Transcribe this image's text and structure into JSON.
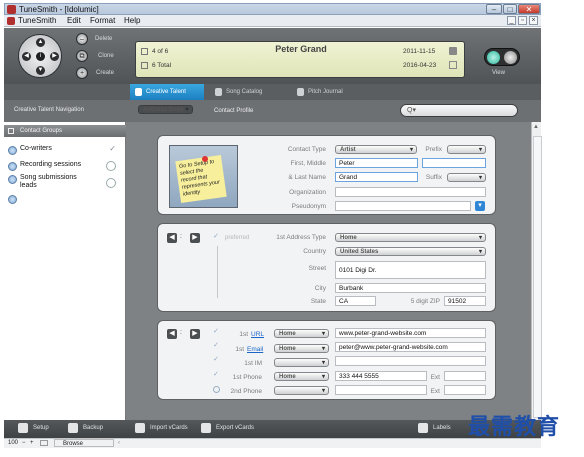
{
  "window": {
    "title": "TuneSmith - [Idolumic]"
  },
  "menu": {
    "app": "TuneSmith",
    "items": [
      "Edit",
      "Format",
      "Help"
    ]
  },
  "toolbar": {
    "delete_label": "Delete",
    "clone_label": "Clone",
    "create_label": "Create",
    "view_label": "View"
  },
  "lcd": {
    "record_pos": "4 of 6",
    "total": "6 Total",
    "name": "Peter Grand",
    "date1": "2011-11-15",
    "date2": "2016-04-23"
  },
  "tabs": [
    {
      "label": "Creative Talent",
      "active": true
    },
    {
      "label": "Song Catalog",
      "active": false
    },
    {
      "label": "Pitch Journal",
      "active": false
    }
  ],
  "subnav": {
    "title": "Creative Talent Navigation",
    "address_book": "Address Book",
    "contact_profile": "Contact Profile",
    "search_icon_text": "Q▾"
  },
  "left": {
    "header": "Contact Groups",
    "groups": [
      {
        "label": "Co-writers",
        "checked": true
      },
      {
        "label": "Recording sessions",
        "checked": false
      },
      {
        "label": "Song submissions leads",
        "checked": false
      }
    ]
  },
  "profile": {
    "sticky_note": "Go to Setup to select the record that represents your identity",
    "contact_type_label": "Contact Type",
    "contact_type": "Artist",
    "prefix_label": "Prefix",
    "prefix": "",
    "first_middle_label": "First, Middle",
    "first": "Peter",
    "middle": "",
    "last_name_label": "& Last Name",
    "last": "Grand",
    "suffix_label": "Suffix",
    "suffix": "",
    "organization_label": "Organization",
    "organization": "",
    "pseudonym_label": "Pseudonym",
    "pseudonym": ""
  },
  "address": {
    "preferred": "preferred",
    "address_type_label": "1st Address Type",
    "address_type": "Home",
    "country_label": "Country",
    "country": "United States",
    "street_label": "Street",
    "street": "0101 Digi Dr.",
    "city_label": "City",
    "city": "Burbank",
    "state_label": "State",
    "state": "CA",
    "zip_label": "5 digit ZIP",
    "zip": "91502"
  },
  "contact": {
    "url_label": "1st",
    "url_link": "URL",
    "url_type": "Home",
    "url": "www.peter-grand-website.com",
    "email_label": "1st",
    "email_link": "Email",
    "email_type": "Home",
    "email": "peter@www.peter-grand-website.com",
    "im_label": "1st IM",
    "im_type": "",
    "im": "",
    "phone_label": "1st Phone",
    "phone_type": "Home",
    "phone": "333 444 5555",
    "ext_label": "Ext",
    "ext": "",
    "phone2_label": "2nd Phone",
    "phone2_type": "",
    "phone2": "",
    "ext2_label": "Ext",
    "ext2": ""
  },
  "bottom": {
    "setup": "Setup",
    "backup": "Backup",
    "import": "Import vCards",
    "export": "Export vCards",
    "labels": "Labels"
  },
  "status": {
    "zoom": "100",
    "mode": "Browse"
  },
  "watermark": "最需教育"
}
